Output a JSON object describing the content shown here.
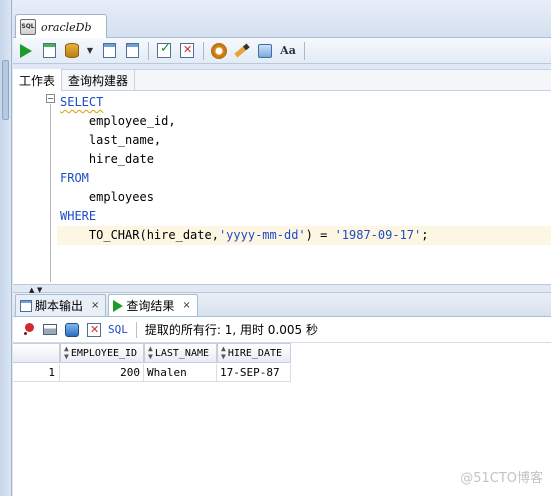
{
  "tab": {
    "title": "oracleDb",
    "db_icon_text": "SQL"
  },
  "toolbar": {
    "icons": [
      "run-statement-icon",
      "run-script-icon",
      "database-commit-icon",
      "dropdown-icon",
      "explain-plan-icon",
      "autotrace-icon",
      "commit-icon",
      "rollback-icon",
      "sql-tuning-icon",
      "clear-icon",
      "history-icon",
      "format-case-icon"
    ],
    "format_label": "Aa"
  },
  "worksheet_tabs": [
    "工作表",
    "查询构建器"
  ],
  "editor": {
    "lines": [
      {
        "segments": [
          {
            "text": "SELECT",
            "cls": "kw kw-squig"
          }
        ]
      },
      {
        "segments": [
          {
            "text": "    employee_id,",
            "cls": ""
          }
        ]
      },
      {
        "segments": [
          {
            "text": "    last_name,",
            "cls": ""
          }
        ]
      },
      {
        "segments": [
          {
            "text": "    hire_date",
            "cls": ""
          }
        ]
      },
      {
        "segments": [
          {
            "text": "FROM",
            "cls": "kw"
          }
        ]
      },
      {
        "segments": [
          {
            "text": "    employees",
            "cls": ""
          }
        ]
      },
      {
        "segments": [
          {
            "text": "WHERE",
            "cls": "kw"
          }
        ]
      },
      {
        "segments": [
          {
            "text": "    TO_CHAR(hire_date,",
            "cls": ""
          },
          {
            "text": "'yyyy-mm-dd'",
            "cls": "str"
          },
          {
            "text": ") = ",
            "cls": ""
          },
          {
            "text": "'1987-09-17'",
            "cls": "str"
          },
          {
            "text": ";",
            "cls": ""
          }
        ],
        "highlight": true
      }
    ],
    "fold_symbol": "−"
  },
  "panel_tabs": [
    {
      "label": "脚本输出",
      "close": "×"
    },
    {
      "label": "查询结果",
      "close": "×"
    }
  ],
  "results_toolbar": {
    "sql_label": "SQL",
    "status": "提取的所有行: 1, 用时 0.005 秒"
  },
  "grid": {
    "columns": [
      "EMPLOYEE_ID",
      "LAST_NAME",
      "HIRE_DATE"
    ],
    "rows": [
      {
        "num": "1",
        "cells": [
          "200",
          "Whalen",
          "17-SEP-87"
        ]
      }
    ]
  },
  "watermark": "@51CTO博客"
}
